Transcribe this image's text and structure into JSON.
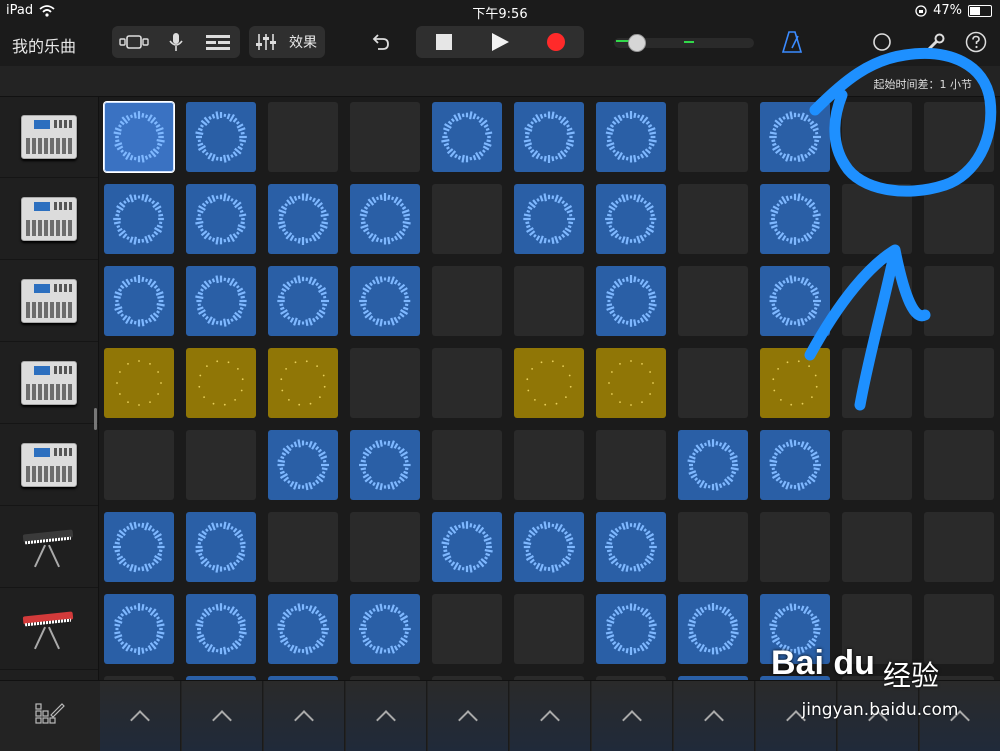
{
  "status_bar": {
    "carrier": "iPad",
    "time": "下午9:56",
    "battery": "47%"
  },
  "toolbar": {
    "song_title": "我的乐曲",
    "effects_label": "效果",
    "level_fraction": 0.18
  },
  "subheader": {
    "time_offset": "起始时间差：1 小节"
  },
  "tracks": [
    {
      "instrument": "drum-machine"
    },
    {
      "instrument": "drum-machine"
    },
    {
      "instrument": "drum-machine"
    },
    {
      "instrument": "drum-machine"
    },
    {
      "instrument": "drum-machine"
    },
    {
      "instrument": "keyboard-synth-dark"
    },
    {
      "instrument": "keyboard-synth-red"
    }
  ],
  "grid": {
    "rows": [
      [
        "sel",
        "blue",
        "empty",
        "empty",
        "blue",
        "blue",
        "blue",
        "empty",
        "blue",
        "empty",
        "empty"
      ],
      [
        "blue",
        "blue",
        "blue",
        "blue",
        "empty",
        "blue",
        "blue",
        "empty",
        "blue",
        "empty",
        "empty"
      ],
      [
        "blue",
        "blue",
        "blue",
        "blue",
        "empty",
        "empty",
        "blue",
        "empty",
        "blue",
        "empty",
        "empty"
      ],
      [
        "yellow",
        "yellow",
        "yellow",
        "empty",
        "empty",
        "yellow",
        "yellow",
        "empty",
        "yellow",
        "empty",
        "empty"
      ],
      [
        "empty",
        "empty",
        "blue",
        "blue",
        "empty",
        "empty",
        "empty",
        "blue",
        "blue",
        "empty",
        "empty"
      ],
      [
        "blue",
        "blue",
        "empty",
        "empty",
        "blue",
        "blue",
        "blue",
        "empty",
        "empty",
        "empty",
        "empty"
      ],
      [
        "blue",
        "blue",
        "blue",
        "blue",
        "empty",
        "empty",
        "blue",
        "blue",
        "blue",
        "empty",
        "empty"
      ],
      [
        "empty",
        "blue",
        "blue",
        "empty",
        "empty",
        "empty",
        "empty",
        "blue",
        "blue",
        "empty",
        "empty"
      ]
    ],
    "colors": {
      "blue": "#2a5fa6",
      "yellow": "#907606",
      "empty": "#2a2a2a",
      "wave": "#7fb8ff",
      "yellow_wave": "#e8cf5a"
    }
  },
  "bottom_bar": {
    "trigger_count": 11
  },
  "annotation": {
    "color": "#1e90ff"
  },
  "watermark": {
    "logo": "Bai du",
    "logo_cn": "经验",
    "url": "jingyan.baidu.com"
  }
}
